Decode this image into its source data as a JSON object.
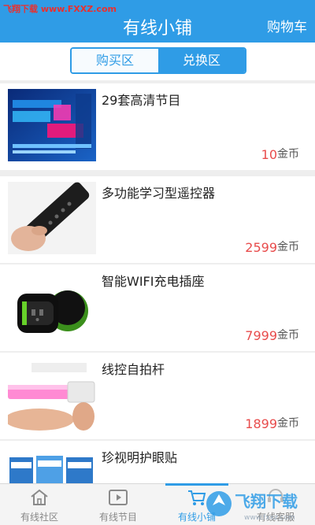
{
  "watermark": "飞翔下载 www.FXXZ.com",
  "header": {
    "title": "有线小铺",
    "cart_label": "购物车"
  },
  "segment": {
    "buy_label": "购买区",
    "exchange_label": "兑换区",
    "selected": "兑换区"
  },
  "products": [
    {
      "name": "29套高清节目",
      "price": "10",
      "unit": "金币",
      "image": "tv-channels-ad"
    },
    {
      "name": "多功能学习型遥控器",
      "price": "2599",
      "unit": "金币",
      "image": "remote-control"
    },
    {
      "name": "智能WIFI充电插座",
      "price": "7999",
      "unit": "金币",
      "image": "smart-plug"
    },
    {
      "name": "线控自拍杆",
      "price": "1899",
      "unit": "金币",
      "image": "selfie-stick"
    },
    {
      "name": "珍视明护眼贴",
      "price": "",
      "unit": "",
      "image": "eye-patch-box"
    }
  ],
  "tabbar": {
    "tabs": [
      {
        "label": "有线社区",
        "icon": "home-icon"
      },
      {
        "label": "有线节目",
        "icon": "play-icon"
      },
      {
        "label": "有线小铺",
        "icon": "cart-icon",
        "active": true
      },
      {
        "label": "有线客服",
        "icon": "service-icon"
      }
    ]
  },
  "overlay_logo": {
    "text": "飞翔下载",
    "subtext": "www.fxxz.com"
  },
  "colors": {
    "primary": "#2f9ce6",
    "price": "#e84c4c"
  }
}
